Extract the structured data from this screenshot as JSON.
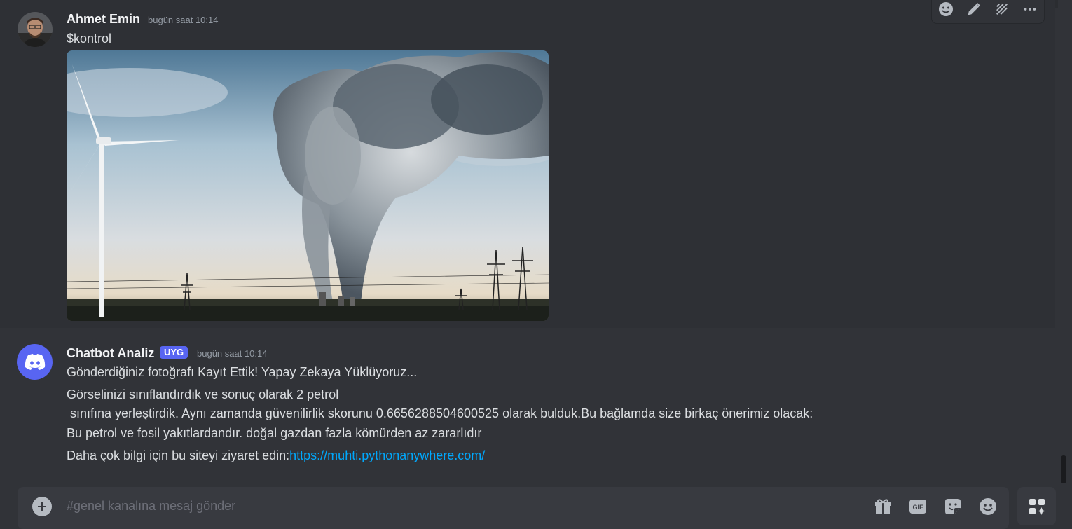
{
  "messages": [
    {
      "username": "Ahmet Emin",
      "timestamp": "bugün saat 10:14",
      "text": "$kontrol",
      "attachment_icon": "image-attachment"
    },
    {
      "username": "Chatbot Analiz",
      "badge": "UYG",
      "timestamp": "bugün saat 10:14",
      "line1": "Gönderdiğiniz fotoğrafı Kayıt Ettik! Yapay Zekaya Yüklüyoruz...",
      "line2": "Görselinizi sınıflandırdık ve sonuç olarak 2 petrol",
      "line3": " sınıfına yerleştirdik. Aynı zamanda güvenilirlik skorunu 0.6656288504600525 olarak bulduk.Bu bağlamda size birkaç önerimiz olacak:",
      "line4": "Bu petrol ve fosil yakıtlardandır. doğal gazdan fazla kömürden az zararlıdır",
      "line5_prefix": "Daha çok bilgi için bu siteyi ziyaret edin:",
      "link": "https://muhti.pythonanywhere.com/"
    }
  ],
  "composer": {
    "placeholder": "#genel kanalına mesaj gönder",
    "icons": [
      "add-icon",
      "gift-icon",
      "gif-icon",
      "sticker-icon",
      "emoji-icon",
      "apps-icon"
    ]
  },
  "hover_toolbar": {
    "icons": [
      "add-reaction-icon",
      "edit-icon",
      "thread-icon",
      "more-icon"
    ]
  },
  "colors": {
    "background": "#313338",
    "accent": "#5865f2",
    "link": "#00a8fc"
  }
}
